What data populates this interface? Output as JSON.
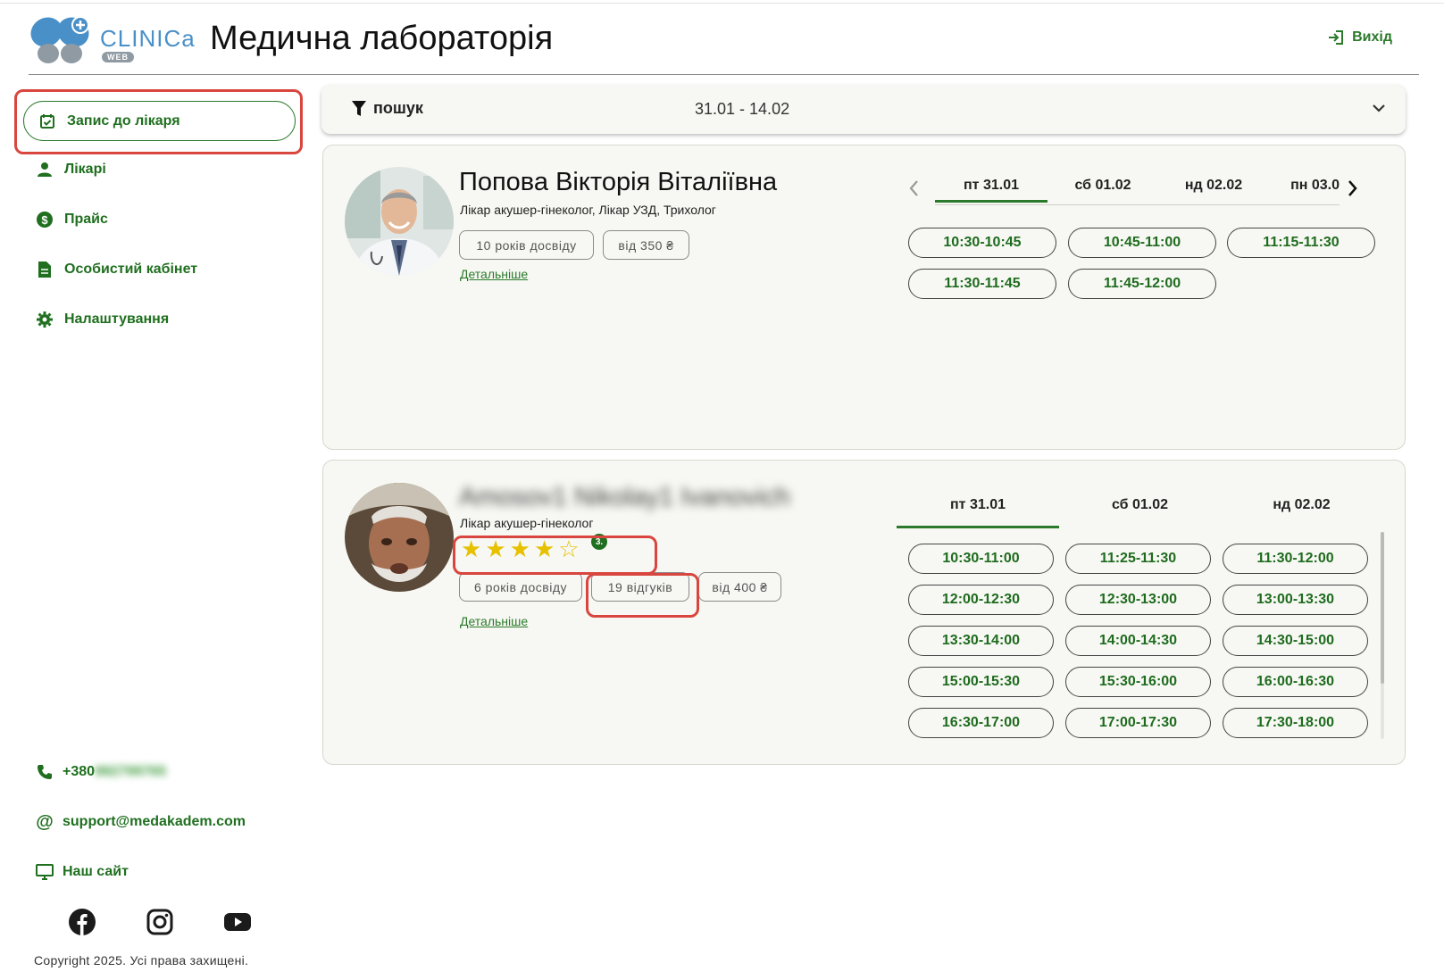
{
  "header": {
    "logo_text": "CLINICa",
    "logo_badge": "WEB",
    "title": "Медична лабораторія",
    "logout_label": "Вихід"
  },
  "sidebar": {
    "items": [
      {
        "label": "Запис до лікаря",
        "icon": "calendar-check-icon",
        "active": true
      },
      {
        "label": "Лікарі",
        "icon": "person-icon"
      },
      {
        "label": "Прайс",
        "icon": "dollar-circle-icon"
      },
      {
        "label": "Особистий кабінет",
        "icon": "document-icon"
      },
      {
        "label": "Налаштування",
        "icon": "gear-icon"
      }
    ]
  },
  "search": {
    "label": "пошук",
    "date_range": "31.01 - 14.02"
  },
  "doctors": [
    {
      "name": "Попова Вікторія Віталіївна",
      "specialty": "Лікар акушер-гінеколог, Лікар УЗД, Трихолог",
      "experience": "10 років досвіду",
      "price": "від 350 ₴",
      "details": "Детальніше",
      "tabs": [
        "пт 31.01",
        "сб 01.02",
        "нд 02.02",
        "пн 03.0"
      ],
      "active_tab": 0,
      "slots": [
        "10:30-10:45",
        "10:45-11:00",
        "11:15-11:30",
        "11:30-11:45",
        "11:45-12:00"
      ]
    },
    {
      "name": "Amosov1 Nikolay1 Ivanovich",
      "specialty": "Лікар акушер-гінеколог",
      "rating_stars": 4,
      "rating_max": 5,
      "rating_badge": "3.",
      "experience": "6 років досвіду",
      "reviews": "19 відгуків",
      "price": "від 400 ₴",
      "details": "Детальніше",
      "tabs": [
        "пт 31.01",
        "сб 01.02",
        "нд 02.02"
      ],
      "active_tab": 0,
      "slots": [
        "10:30-11:00",
        "11:25-11:30",
        "11:30-12:00",
        "12:00-12:30",
        "12:30-13:00",
        "13:00-13:30",
        "13:30-14:00",
        "14:00-14:30",
        "14:30-15:00",
        "15:00-15:30",
        "15:30-16:00",
        "16:00-16:30",
        "16:30-17:00",
        "17:00-17:30",
        "17:30-18:00"
      ]
    }
  ],
  "contacts": {
    "phone_prefix": "+380",
    "phone_hidden": "982799765",
    "email": "support@medakadem.com",
    "site": "Наш сайт"
  },
  "social": [
    "facebook-icon",
    "instagram-icon",
    "youtube-icon"
  ],
  "copyright": "Copyright 2025. Усі права захищені.",
  "colors": {
    "accent": "#2b7a2b",
    "card_bg": "#f7f8f3",
    "highlight": "#d9463f",
    "star": "#e7c000"
  }
}
